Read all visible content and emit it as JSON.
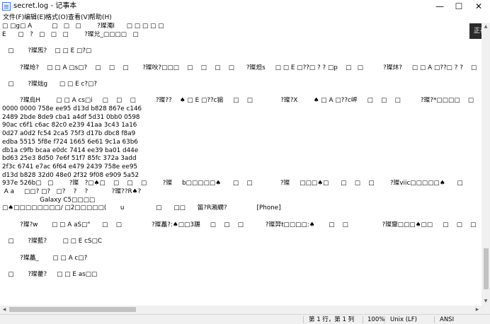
{
  "window": {
    "title": "secret.log - 记事本",
    "minimize": "—",
    "maximize": "☐",
    "close": "✕",
    "icon": "notepad-icon"
  },
  "menu": [
    "文件(F)",
    "编辑(E)",
    "格式(O)",
    "查看(V)",
    "帮助(H)"
  ],
  "side_tab": "正在访问",
  "content": [
    "□ □g□ A          □   □   □        ?璨濁I      □ □ □ □ □",
    "E      □   ?   □   □   □        ?璨兊_□□□□   □",
    "",
    "   □       ?璨炁?    □ □ E □?□",
    "",
    "         ?璨炝?    □ □ A □s□?    □    □    □       ?璨吙?□□□    □    □    □    □      ?璨炟s     □ □ E □??□ ? ? □p    □   □          ?璨炑?     □ □ A □??□ ? ?    □    □    □      ?璨炵]",
    "",
    "   □       ?璨炪g      □ □ E c?□?",
    "",
    "         ?璨烏H        □ □ A cs□i     □    □    □          ?璨??    ♠ □ E □??c猏     □    □              ?璨?X        ♠ □ A □??c岼     □    □    □          ?璨?*□□□□    □    □    □                 ?璨??       ♠ □ A □?",
    "0000 0000 758e ee95 d13d b828 867e c146",
    "2489 2bde 8de9 cba1 a4df 5d31 0bb0 0598",
    "90ac c6f1 c6ac 82c0 e239 41aa 3c43 1a16",
    "0d27 a0d2 fc54 2ca5 75f3 d17b dbc8 f8a9",
    "edba 5515 5f8e f724 1665 6e61 9c1a 63b6",
    "db1a c9fb bcaa e0dc 7414 ee39 ba01 d44e",
    "bd63 25e3 8d50 7e6f 51f7 85fc 372a 3add",
    "2f3c 6741 e7ac 6f64 e479 2439 758e ee95",
    "d13d b828 32d0 48e0 2f32 9f08 e909 5a52",
    "937e 526b□   □        ?璨   ?□♠□    □    □    □        ?璨     b□□□□□♠      □    □              ?璨     □□□♠□      □    □    □        ?璨viic□□□□□♠      □              ?璨(r)?□♠□     □",
    " A a     □□? □?   □?    ?    ?            ?璨??R♠?",
    "                   Galaxy C5□□□□",
    "□♠□□□□□□□□/ □2□□□□□(       u                □      □□      笛?R潲繝?               [Phone]",
    "",
    "         ?璨?w       □ □ A aS□\"      □    □               ?璨藟?:♠□□3蹍     □    □    □           ?璨羿t□□□□:♠       □    □                 ?璨齎□□□♠□□     □    □    □           ?璨藆R□□□□□♠     □       □",
    "",
    "   □       ?璨藍?        □ □ E cS□C",
    "",
    "         ?璨藟_       □ □ A c□?",
    "",
    "   □       ?璨藿?     □ □ E as□□"
  ],
  "status": {
    "position": "第 1 行，第 1 列",
    "zoom": "100%",
    "line_ending": "Unix (LF)",
    "encoding": "ANSI"
  }
}
